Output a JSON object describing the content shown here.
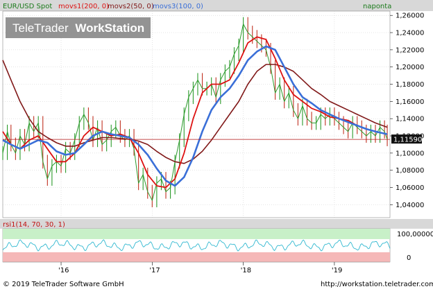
{
  "header": {
    "instrument": "EUR/USD Spot",
    "indicators": [
      "movs1(200, 0)",
      "movs2(50, 0)",
      "movs3(100, 0)"
    ],
    "period_label": "naponta"
  },
  "watermark": {
    "part1": "TeleTrader",
    "part2": "WorkStation"
  },
  "rsi_panel": {
    "label": "rsi1(14, 70, 30, 1)",
    "tick_top": "100,00000",
    "tick_bottom": "0"
  },
  "footer": {
    "copyright": "© 2019 TeleTrader Software GmbH",
    "url": "http://workstation.teletrader.com"
  },
  "colors": {
    "price": "#2a9a2a",
    "down": "#c03020",
    "ma50": "#dd1111",
    "ma100": "#3a6fd8",
    "ma200": "#801818",
    "header_bg": "#d8d8d8",
    "rsi_upper_band": "#c8f0c8",
    "rsi_lower_band": "#f5b8b8",
    "rsi_line": "#30b8d0",
    "current_price_bg": "#111111"
  },
  "chart_data": {
    "type": "line",
    "y_tick_labels": [
      "1,26000",
      "1,24000",
      "1,22000",
      "1,20000",
      "1,18000",
      "1,16000",
      "1,14000",
      "1,12000",
      "1,10000",
      "1,08000",
      "1,06000",
      "1,04000"
    ],
    "y_ticks": [
      1.26,
      1.24,
      1.22,
      1.2,
      1.18,
      1.16,
      1.14,
      1.12,
      1.1,
      1.08,
      1.06,
      1.04
    ],
    "ylim": [
      1.025,
      1.265
    ],
    "x_tick_labels": [
      "'16",
      "'17",
      "'18",
      "'19"
    ],
    "x_ticks": [
      2016.0,
      2017.0,
      2018.0,
      2019.0
    ],
    "xlim": [
      2015.36,
      2019.61
    ],
    "current_price": 1.1159,
    "current_price_label": "1,11590",
    "series": [
      {
        "name": "EUR/USD Spot",
        "key": "price",
        "x": [
          2015.36,
          2015.41,
          2015.45,
          2015.5,
          2015.55,
          2015.6,
          2015.65,
          2015.7,
          2015.75,
          2015.8,
          2015.85,
          2015.9,
          2015.95,
          2016.0,
          2016.05,
          2016.1,
          2016.15,
          2016.2,
          2016.25,
          2016.3,
          2016.35,
          2016.4,
          2016.45,
          2016.5,
          2016.55,
          2016.6,
          2016.65,
          2016.7,
          2016.75,
          2016.8,
          2016.85,
          2016.9,
          2016.95,
          2017.0,
          2017.05,
          2017.1,
          2017.15,
          2017.2,
          2017.25,
          2017.3,
          2017.35,
          2017.4,
          2017.45,
          2017.5,
          2017.55,
          2017.6,
          2017.65,
          2017.7,
          2017.75,
          2017.8,
          2017.85,
          2017.9,
          2017.95,
          2018.0,
          2018.05,
          2018.1,
          2018.15,
          2018.2,
          2018.25,
          2018.3,
          2018.35,
          2018.4,
          2018.45,
          2018.5,
          2018.55,
          2018.6,
          2018.65,
          2018.7,
          2018.75,
          2018.8,
          2018.85,
          2018.9,
          2018.95,
          2019.0,
          2019.05,
          2019.1,
          2019.15,
          2019.2,
          2019.25,
          2019.3,
          2019.35,
          2019.4,
          2019.45,
          2019.5,
          2019.55,
          2019.58
        ],
        "y": [
          1.1,
          1.125,
          1.11,
          1.1,
          1.12,
          1.11,
          1.135,
          1.125,
          1.135,
          1.09,
          1.07,
          1.085,
          1.09,
          1.085,
          1.105,
          1.1,
          1.115,
          1.135,
          1.145,
          1.135,
          1.115,
          1.13,
          1.11,
          1.115,
          1.125,
          1.13,
          1.12,
          1.115,
          1.12,
          1.105,
          1.065,
          1.075,
          1.055,
          1.045,
          1.065,
          1.07,
          1.055,
          1.06,
          1.09,
          1.115,
          1.145,
          1.165,
          1.175,
          1.185,
          1.175,
          1.175,
          1.18,
          1.165,
          1.185,
          1.195,
          1.2,
          1.215,
          1.225,
          1.25,
          1.24,
          1.235,
          1.23,
          1.225,
          1.22,
          1.2,
          1.17,
          1.18,
          1.16,
          1.17,
          1.15,
          1.14,
          1.155,
          1.14,
          1.135,
          1.135,
          1.145,
          1.14,
          1.145,
          1.14,
          1.135,
          1.13,
          1.125,
          1.135,
          1.13,
          1.125,
          1.12,
          1.125,
          1.12,
          1.13,
          1.125,
          1.116
        ]
      },
      {
        "name": "movs2(50, 0)",
        "key": "ma50",
        "x": [
          2015.36,
          2015.45,
          2015.55,
          2015.65,
          2015.75,
          2015.85,
          2015.95,
          2016.05,
          2016.15,
          2016.25,
          2016.35,
          2016.45,
          2016.55,
          2016.65,
          2016.75,
          2016.85,
          2016.95,
          2017.05,
          2017.15,
          2017.25,
          2017.35,
          2017.45,
          2017.55,
          2017.65,
          2017.75,
          2017.85,
          2017.95,
          2018.05,
          2018.15,
          2018.25,
          2018.35,
          2018.45,
          2018.55,
          2018.65,
          2018.75,
          2018.85,
          2018.95,
          2019.05,
          2019.15,
          2019.25,
          2019.35,
          2019.45,
          2019.58
        ],
        "y": [
          1.125,
          1.11,
          1.105,
          1.115,
          1.12,
          1.105,
          1.09,
          1.09,
          1.1,
          1.12,
          1.13,
          1.125,
          1.12,
          1.122,
          1.118,
          1.1,
          1.075,
          1.062,
          1.06,
          1.07,
          1.1,
          1.14,
          1.17,
          1.18,
          1.18,
          1.185,
          1.205,
          1.228,
          1.235,
          1.232,
          1.21,
          1.185,
          1.168,
          1.16,
          1.152,
          1.148,
          1.142,
          1.14,
          1.138,
          1.132,
          1.128,
          1.125,
          1.122
        ]
      },
      {
        "name": "movs3(100, 0)",
        "key": "ma100",
        "x": [
          2015.36,
          2015.45,
          2015.55,
          2015.65,
          2015.75,
          2015.85,
          2015.95,
          2016.05,
          2016.15,
          2016.25,
          2016.35,
          2016.45,
          2016.55,
          2016.65,
          2016.75,
          2016.85,
          2016.95,
          2017.05,
          2017.15,
          2017.25,
          2017.35,
          2017.45,
          2017.55,
          2017.65,
          2017.75,
          2017.85,
          2017.95,
          2018.05,
          2018.15,
          2018.25,
          2018.35,
          2018.45,
          2018.55,
          2018.65,
          2018.75,
          2018.85,
          2018.95,
          2019.05,
          2019.15,
          2019.25,
          2019.35,
          2019.45,
          2019.58
        ],
        "y": [
          1.115,
          1.11,
          1.105,
          1.11,
          1.115,
          1.112,
          1.102,
          1.098,
          1.1,
          1.11,
          1.12,
          1.125,
          1.122,
          1.12,
          1.118,
          1.11,
          1.098,
          1.082,
          1.068,
          1.062,
          1.072,
          1.095,
          1.125,
          1.15,
          1.165,
          1.175,
          1.19,
          1.208,
          1.218,
          1.224,
          1.22,
          1.2,
          1.18,
          1.165,
          1.158,
          1.15,
          1.145,
          1.14,
          1.136,
          1.132,
          1.128,
          1.125,
          1.122
        ]
      },
      {
        "name": "movs1(200, 0)",
        "key": "ma200",
        "x": [
          2015.36,
          2015.45,
          2015.55,
          2015.65,
          2015.75,
          2015.85,
          2015.95,
          2016.05,
          2016.15,
          2016.25,
          2016.35,
          2016.45,
          2016.55,
          2016.65,
          2016.75,
          2016.85,
          2016.95,
          2017.05,
          2017.15,
          2017.25,
          2017.35,
          2017.45,
          2017.55,
          2017.65,
          2017.75,
          2017.85,
          2017.95,
          2018.05,
          2018.15,
          2018.25,
          2018.35,
          2018.45,
          2018.55,
          2018.65,
          2018.75,
          2018.85,
          2018.95,
          2019.05,
          2019.15,
          2019.25,
          2019.35,
          2019.45,
          2019.58
        ],
        "y": [
          1.208,
          1.185,
          1.16,
          1.14,
          1.125,
          1.118,
          1.112,
          1.108,
          1.108,
          1.112,
          1.115,
          1.118,
          1.118,
          1.117,
          1.116,
          1.114,
          1.11,
          1.102,
          1.095,
          1.09,
          1.088,
          1.093,
          1.102,
          1.115,
          1.13,
          1.145,
          1.16,
          1.18,
          1.195,
          1.203,
          1.203,
          1.2,
          1.195,
          1.185,
          1.175,
          1.168,
          1.16,
          1.155,
          1.15,
          1.145,
          1.14,
          1.135,
          1.13
        ]
      }
    ]
  }
}
